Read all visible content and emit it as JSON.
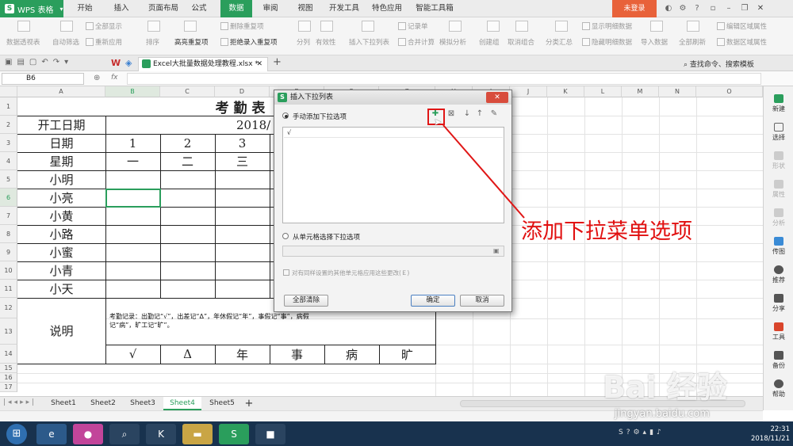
{
  "app": {
    "name": "WPS 表格",
    "logo": "S"
  },
  "menu_tabs": [
    "开始",
    "插入",
    "页面布局",
    "公式",
    "数据",
    "审阅",
    "视图",
    "开发工具",
    "特色应用",
    "智能工具箱"
  ],
  "active_tab": "数据",
  "login_label": "未登录",
  "ribbon": {
    "pivot": "数据透视表",
    "autofilter": "自动筛选",
    "show_all": "全部显示",
    "reapply": "重新应用",
    "sort": "排序",
    "highlight_dup": "高亮重复项",
    "delete_dup": "删除重复项",
    "reject_dup": "拒绝录入重复项",
    "split": "分列",
    "validity": "有效性",
    "insert_dropdown": "插入下拉列表",
    "record_form": "记录单",
    "merge_calc": "合并计算",
    "simulate": "模拟分析",
    "create_group": "创建组",
    "ungroup": "取消组合",
    "subtotal": "分类汇总",
    "show_detail": "显示明细数据",
    "hide_detail": "隐藏明细数据",
    "import": "导入数据",
    "refresh_all": "全部刷新",
    "edit_area": "编辑区域属性",
    "area_props": "数据区域属性",
    "search_hint": "查找命令、搜索模板"
  },
  "doc_tab": "Excel大批量数据处理教程.xlsx *",
  "formula_bar": {
    "cell_ref": "B6",
    "fx": "fx"
  },
  "columns": [
    "A",
    "B",
    "C",
    "D",
    "E",
    "F",
    "G",
    "H",
    "I",
    "J",
    "K",
    "L",
    "M",
    "N",
    "O"
  ],
  "rows": [
    "1",
    "2",
    "3",
    "4",
    "5",
    "6",
    "7",
    "8",
    "9",
    "10",
    "11",
    "12",
    "13",
    "14",
    "15",
    "16",
    "17"
  ],
  "sheet": {
    "title": "考 勤 表",
    "start_label": "开工日期",
    "start_value": "2018/",
    "date_label": "日期",
    "weekday_label": "星期",
    "days": [
      "1",
      "2",
      "3"
    ],
    "weekdays": [
      "一",
      "二",
      "三"
    ],
    "names": [
      "小明",
      "小亮",
      "小黄",
      "小路",
      "小蜜",
      "小青",
      "小天"
    ],
    "note_label": "说明",
    "note_text": "考勤记录：出勤记“√”，出差记“Δ”，年休假记“年”，事假记“事”，病假记“病”，旷工记“旷”。",
    "legend": [
      "√",
      "Δ",
      "年",
      "事",
      "病",
      "旷"
    ]
  },
  "sheet_tabs": [
    "Sheet1",
    "Sheet2",
    "Sheet3",
    "Sheet4",
    "Sheet5"
  ],
  "active_sheet": "Sheet4",
  "right_panel": [
    "新建",
    "选择",
    "形状",
    "属性",
    "分析",
    "传图",
    "推荐",
    "分享",
    "工具",
    "备份",
    "帮助"
  ],
  "dialog": {
    "title": "插入下拉列表",
    "manual_option": "手动添加下拉选项",
    "list_items": [
      "√"
    ],
    "cell_option": "从单元格选择下拉选项",
    "apply_checkbox": "对有同样设置的其他单元格应用这些更改(Ｅ)",
    "clear_all": "全部清除",
    "ok": "确定",
    "cancel": "取消",
    "close": "✕"
  },
  "annotation": "添加下拉菜单选项",
  "watermark": {
    "brand": "Bai 经验",
    "url": "jingyan.baidu.com"
  },
  "taskbar": {
    "time": "22:31",
    "date": "2018/11/21"
  },
  "colors": {
    "accent": "#2a9e5c",
    "login": "#e8623a",
    "annotation": "#e11010",
    "taskbar": "#18324e"
  }
}
